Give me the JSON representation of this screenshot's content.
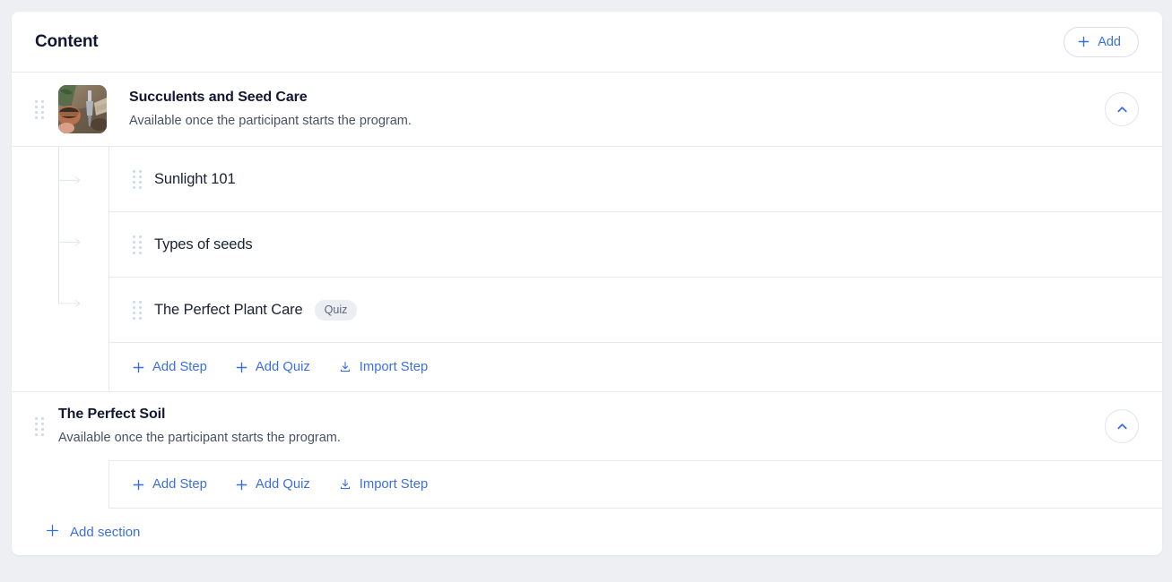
{
  "header": {
    "title": "Content",
    "add_button": {
      "label": "Add",
      "icon": "plus-icon"
    }
  },
  "colors": {
    "accent_blue": "#3b6fe0",
    "page_background": "#edeff3",
    "card_background": "#ffffff",
    "border": "#e7e9ee",
    "title_text": "#131634",
    "badge_background": "#eceef3",
    "badge_text": "#5d6478",
    "drag_dot": "#c9d8ef"
  },
  "sections": [
    {
      "title": "Succulents and Seed Care",
      "subtitle": "Available once the participant starts the program.",
      "has_thumbnail": true,
      "thumbnail_alt": "gardening pots with soil and tools",
      "expanded": true,
      "collapse_icon": "chevron-up-icon",
      "steps": [
        {
          "title": "Sunlight 101",
          "badge": null
        },
        {
          "title": "Types of seeds",
          "badge": null
        },
        {
          "title": "The Perfect Plant Care",
          "badge": "Quiz"
        }
      ],
      "actions": [
        {
          "label": "Add Step",
          "icon": "plus-icon"
        },
        {
          "label": "Add Quiz",
          "icon": "plus-icon"
        },
        {
          "label": "Import Step",
          "icon": "download-icon"
        }
      ]
    },
    {
      "title": "The Perfect Soil",
      "subtitle": "Available once the participant starts the program.",
      "has_thumbnail": false,
      "thumbnail_alt": null,
      "expanded": true,
      "collapse_icon": "chevron-up-icon",
      "steps": [],
      "actions": [
        {
          "label": "Add Step",
          "icon": "plus-icon"
        },
        {
          "label": "Add Quiz",
          "icon": "plus-icon"
        },
        {
          "label": "Import Step",
          "icon": "download-icon"
        }
      ]
    }
  ],
  "footer": {
    "add_section": {
      "label": "Add section",
      "icon": "plus-icon"
    }
  }
}
